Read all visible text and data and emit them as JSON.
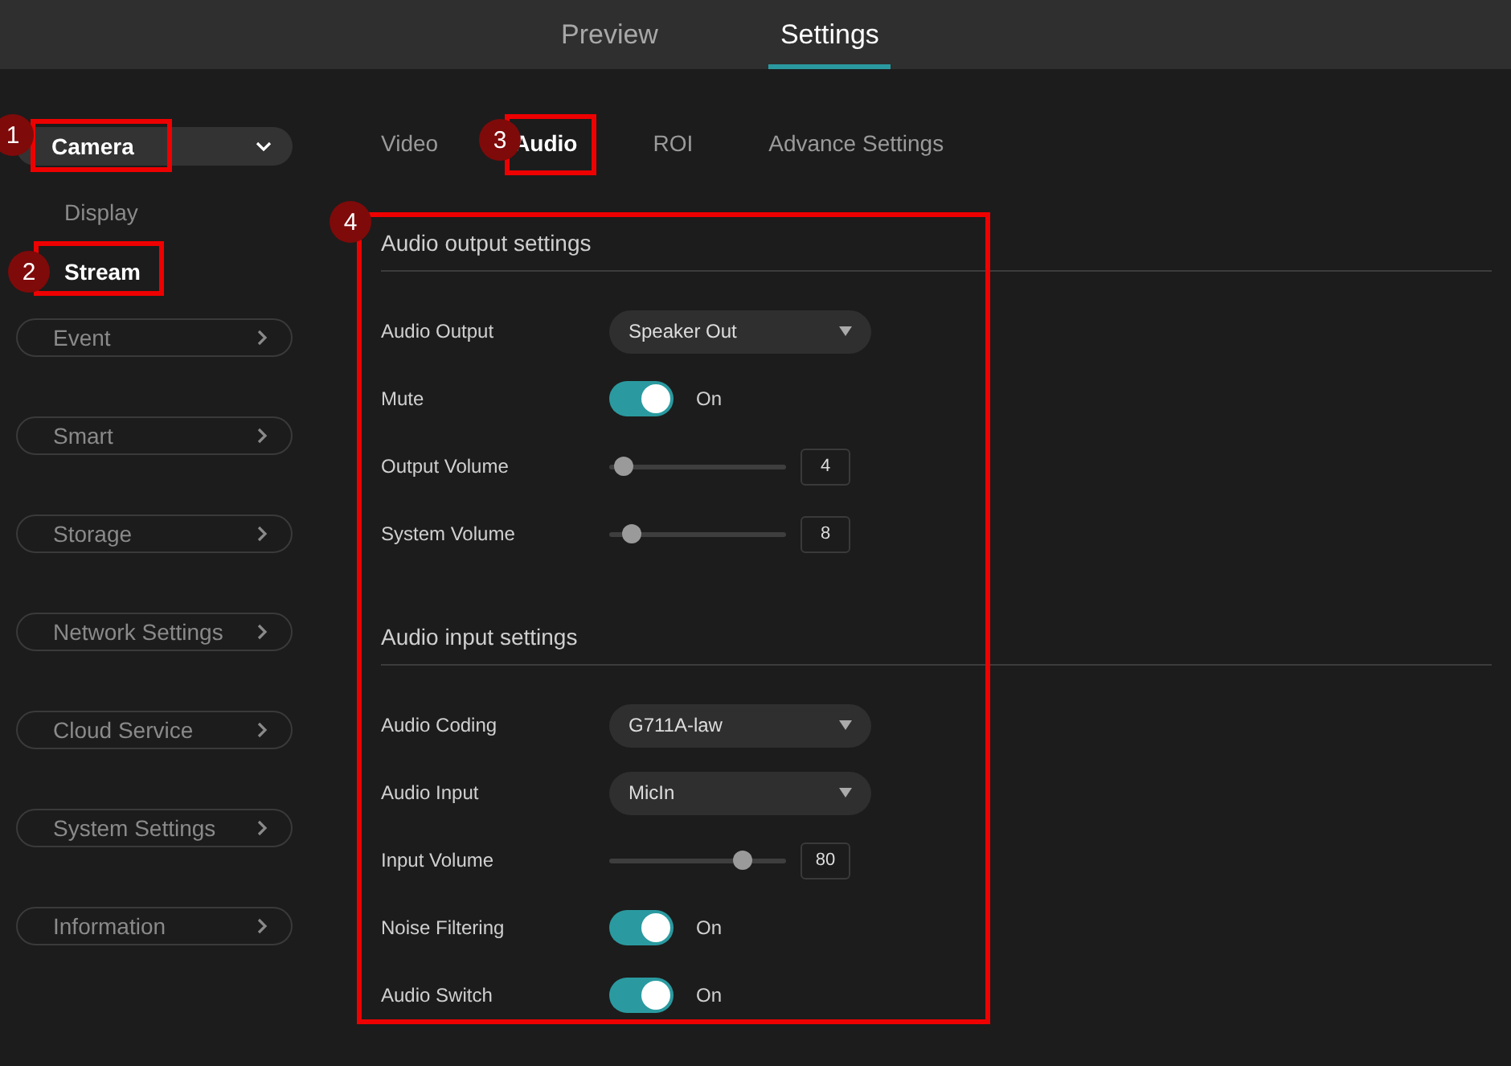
{
  "top_tabs": [
    {
      "label": "Preview",
      "selected": false
    },
    {
      "label": "Settings",
      "selected": true
    }
  ],
  "sidebar": {
    "items": [
      {
        "label": "Camera",
        "expanded": true,
        "children": [
          {
            "label": "Display",
            "selected": false
          },
          {
            "label": "Stream",
            "selected": true
          }
        ]
      },
      {
        "label": "Event",
        "expanded": false
      },
      {
        "label": "Smart",
        "expanded": false
      },
      {
        "label": "Storage",
        "expanded": false
      },
      {
        "label": "Network Settings",
        "expanded": false
      },
      {
        "label": "Cloud Service",
        "expanded": false
      },
      {
        "label": "System Settings",
        "expanded": false
      },
      {
        "label": "Information",
        "expanded": false
      }
    ]
  },
  "sub_tabs": [
    {
      "label": "Video",
      "selected": false
    },
    {
      "label": "Audio",
      "selected": true
    },
    {
      "label": "ROI",
      "selected": false
    },
    {
      "label": "Advance Settings",
      "selected": false
    }
  ],
  "sections": [
    {
      "title": "Audio output settings",
      "rows": [
        {
          "kind": "select",
          "label": "Audio Output",
          "value": "Speaker Out"
        },
        {
          "kind": "toggle",
          "label": "Mute",
          "on": true,
          "state_text": "On"
        },
        {
          "kind": "slider",
          "label": "Output Volume",
          "level": 0.08,
          "value": "4"
        },
        {
          "kind": "slider",
          "label": "System Volume",
          "level": 0.13,
          "value": "8"
        }
      ]
    },
    {
      "title": "Audio input settings",
      "rows": [
        {
          "kind": "select",
          "label": "Audio Coding",
          "value": "G711A-law"
        },
        {
          "kind": "select",
          "label": "Audio Input",
          "value": "MicIn"
        },
        {
          "kind": "slider",
          "label": "Input Volume",
          "level": 0.75,
          "value": "80"
        },
        {
          "kind": "toggle",
          "label": "Noise Filtering",
          "on": true,
          "state_text": "On"
        },
        {
          "kind": "toggle",
          "label": "Audio Switch",
          "on": true,
          "state_text": "On"
        }
      ]
    }
  ],
  "callouts": [
    {
      "label": "1"
    },
    {
      "label": "2"
    },
    {
      "label": "3"
    },
    {
      "label": "4"
    }
  ]
}
